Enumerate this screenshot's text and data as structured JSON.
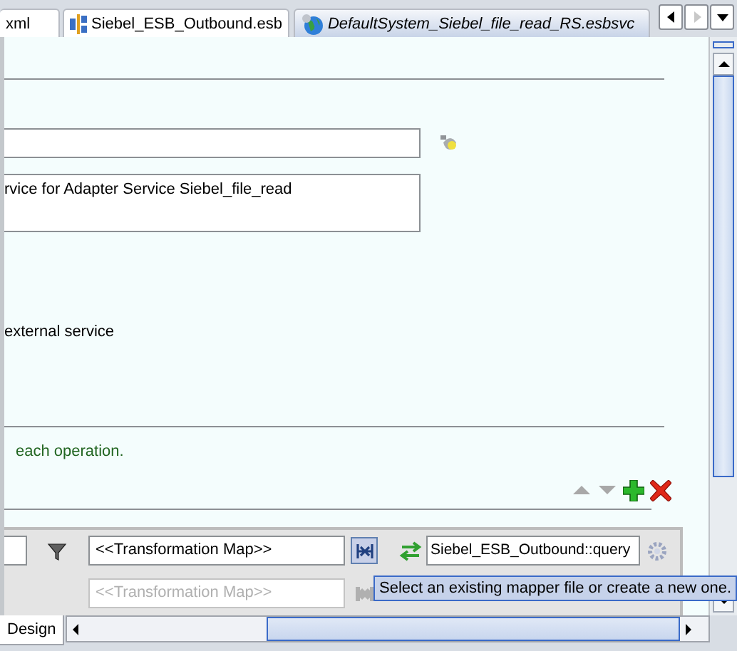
{
  "tabs": [
    {
      "label": "xml",
      "selected": false,
      "kind": "plain"
    },
    {
      "label": "Siebel_ESB_Outbound.esb",
      "selected": false,
      "kind": "esb"
    },
    {
      "label": "DefaultSystem_Siebel_file_read_RS.esbsvc",
      "selected": true,
      "kind": "service"
    }
  ],
  "form": {
    "description": "rvice for Adapter Service Siebel_file_read",
    "note": "external service",
    "hint": "each operation."
  },
  "routing": {
    "rows": [
      {
        "transformation": "<<Transformation Map>>",
        "disabled": false,
        "target": "Siebel_ESB_Outbound::query"
      },
      {
        "transformation": "<<Transformation Map>>",
        "disabled": true
      }
    ]
  },
  "tooltip": "Select an existing mapper file or create a new one.",
  "bottom_tabs": [
    {
      "label": "Design",
      "selected": true
    }
  ]
}
